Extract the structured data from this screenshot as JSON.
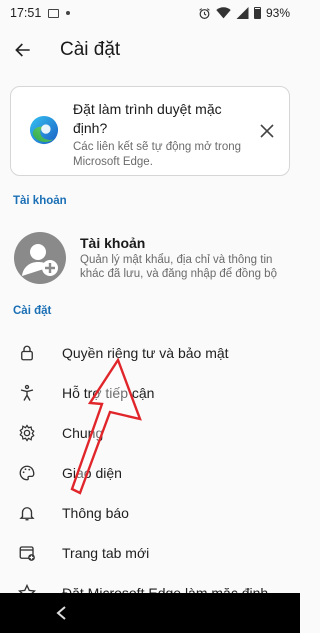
{
  "status_bar": {
    "time": "17:51",
    "battery_pct": "93%"
  },
  "app_bar": {
    "title": "Cài đặt"
  },
  "banner": {
    "title": "Đặt làm trình duyệt mặc định?",
    "subtitle": "Các liên kết sẽ tự động mở trong Microsoft Edge."
  },
  "sections": {
    "account_header": "Tài khoản",
    "settings_header": "Cài đặt"
  },
  "account": {
    "title": "Tài khoản",
    "description": "Quản lý mật khẩu, địa chỉ và thông tin khác đã lưu, và đăng nhập để đồng bộ"
  },
  "settings_items": [
    {
      "label": "Quyền riêng tư và bảo mật",
      "icon": "lock-icon"
    },
    {
      "label": "Hỗ trợ tiếp cận",
      "icon": "accessibility-icon"
    },
    {
      "label": "Chung",
      "icon": "gear-icon"
    },
    {
      "label": "Giao diện",
      "icon": "palette-icon"
    },
    {
      "label": "Thông báo",
      "icon": "bell-icon"
    },
    {
      "label": "Trang tab mới",
      "icon": "new-tab-icon"
    },
    {
      "label": "Đặt Microsoft Edge làm mặc định",
      "icon": "star-icon"
    }
  ],
  "colors": {
    "accent": "#1a6fb5",
    "annotation_arrow": "#e0262b"
  }
}
